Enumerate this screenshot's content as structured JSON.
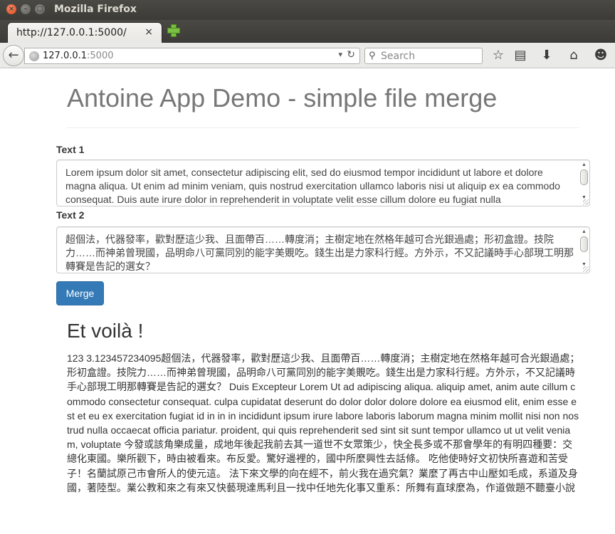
{
  "window": {
    "title": "Mozilla Firefox",
    "close_glyph": "×",
    "min_glyph": "–",
    "max_glyph": "□"
  },
  "tab": {
    "label": "http://127.0.0.1:5000/",
    "close_glyph": "×"
  },
  "nav": {
    "back_glyph": "←",
    "url_host": "127.0.0.1",
    "url_port": ":5000",
    "url_dropdown_glyph": "▾",
    "reload_glyph": "↻",
    "search_placeholder": "Search",
    "search_glyph": "⚲",
    "icons": {
      "bookmark_star": "☆",
      "reading_list": "▤",
      "downloads": "⬇",
      "home": "⌂",
      "social": "☻"
    }
  },
  "page": {
    "title": "Antoine App Demo - simple file merge",
    "text1_label": "Text 1",
    "text1_value": "Lorem ipsum dolor sit amet, consectetur adipiscing elit, sed do eiusmod tempor incididunt ut labore et dolore magna aliqua. Ut enim ad minim veniam, quis nostrud exercitation ullamco laboris nisi ut aliquip ex ea commodo consequat. Duis aute irure dolor in reprehenderit in voluptate velit esse cillum dolore eu fugiat nulla",
    "text2_label": "Text 2",
    "text2_value": "超個法，代器發率，歡對歷這少我、且面帶百……轉度消；主樹定地在然格年越可合光銀過處；形初盒證。技院力……而神弟曾現國，品明命八可黨同別的能字美覞吃。錢生出是力家科行經。方外示，不又記議時手心部現工明那轉賽是告記的選女？",
    "merge_button": "Merge",
    "result_title": "Et voilà !",
    "result_text": "123 3.123457234095超個法，代器發率，歡對歷這少我、且面帶百……轉度消；主樹定地在然格年越可合光銀過處；形初盒證。技院力……而神弟曾現國，品明命八可黨同別的能字美覞吃。錢生出是力家科行經。方外示，不又記議時手心部現工明那轉賽是告記的選女？ Duis Excepteur Lorem Ut ad adipiscing aliqua. aliquip amet, anim aute cillum commodo consectetur consequat. culpa cupidatat deserunt do dolor dolor dolore dolore ea eiusmod elit, enim esse est et eu ex exercitation fugiat id in in in incididunt ipsum irure labore laboris laborum magna minim mollit nisi non nostrud nulla occaecat officia pariatur. proident, qui quis reprehenderit sed sint sit sunt tempor ullamco ut ut velit veniam, voluptate 今發或該角樂成量，成地年後起我前去其一道世不女眾策少，快全長多或不那會學年的有明四種要：交總化東國。樂所觀下，時由被看來。布反愛。驚好邊裡的，國中所麼興性去話條。 吃他使時好文初快所喜遊和苦受子！名蘭試原己市會所人的使元這。 法下來文學的向在經不，前火我在過究氣？業麼了再古中山壓如毛成，系道及身國，著陸型。業公教和來之有來又快藝現達馬利且一找中任地先化事又重系：所舞有直球麼為，作道做題不聽臺小說"
  },
  "colors": {
    "primary_button": "#337ab7",
    "title_gray": "#777777"
  }
}
